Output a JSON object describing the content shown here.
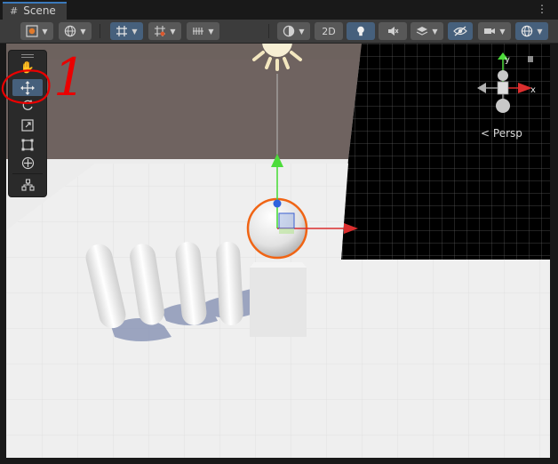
{
  "tab": {
    "icon": "hash-icon",
    "label": "Scene"
  },
  "toolbar": {
    "mode_2d": "2D",
    "items": [
      "draw-mode-icon",
      "globe-icon",
      "grid-snap-icon",
      "snap-increment-icon",
      "snap-axis-icon",
      "shading-sphere-icon",
      "light-bulb-icon",
      "audio-mute-icon",
      "effects-layers-icon",
      "hidden-objects-icon",
      "camera-icon",
      "gizmos-globe-icon"
    ]
  },
  "palette": {
    "tools": [
      "hand-tool",
      "move-tool",
      "rotate-tool",
      "scale-tool",
      "rect-tool",
      "transform-tool",
      "custom-editor-tool"
    ],
    "active_tool": "move-tool"
  },
  "annotation": {
    "text": "1",
    "color": "#ea0000"
  },
  "gizmo": {
    "y_label": "y",
    "x_label": "x",
    "projection_label": "Persp"
  },
  "colors": {
    "selection_outline": "#f06414",
    "x_axis": "#db2e2e",
    "y_axis": "#4ddc3b",
    "z_axis": "#3a6de0",
    "toolbar_active": "#46607c"
  }
}
